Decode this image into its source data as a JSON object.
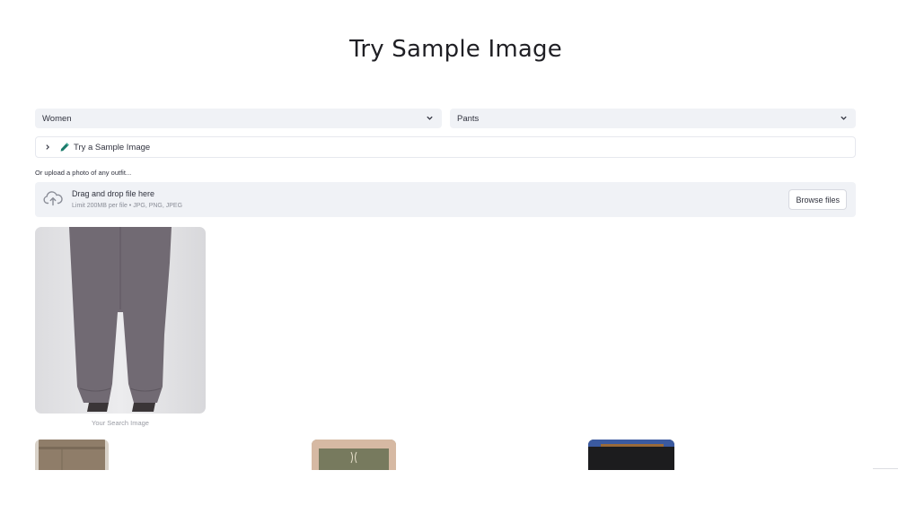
{
  "page": {
    "title": "Try Sample Image"
  },
  "filters": {
    "gender": {
      "selected": "Women"
    },
    "category": {
      "selected": "Pants"
    }
  },
  "expander": {
    "label": "Try a Sample Image",
    "icon": "pen-icon"
  },
  "upload": {
    "hint": "Or upload a photo of any outfit...",
    "title": "Drag and drop file here",
    "limit": "Limit 200MB per file • JPG, PNG, JPEG",
    "browse_label": "Browse files",
    "icon": "cloud-upload-icon"
  },
  "search_image": {
    "caption": "Your Search Image"
  },
  "colors": {
    "field_bg": "#f0f2f6",
    "text": "#31333f",
    "muted": "#8a8d97",
    "pen": "#1a7a6a"
  }
}
